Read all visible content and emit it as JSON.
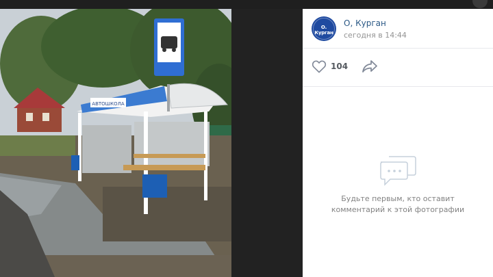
{
  "post": {
    "group_name": "О, Курган",
    "avatar_text": "О. Курган",
    "timestamp": "сегодня в 14:44"
  },
  "actions": {
    "like_count": "104"
  },
  "comments": {
    "empty_line1": "Будьте первым, кто оставит",
    "empty_line2": "комментарий к этой фотографии"
  },
  "photo": {
    "shelter_sign": "АВТОШКОЛА"
  },
  "colors": {
    "link": "#2a5885",
    "muted": "#939393",
    "icon": "#828a99",
    "accent": "#1f4aa0"
  },
  "icons": {
    "like": "heart-icon",
    "share": "share-arrow-icon",
    "empty_comments": "speech-bubble-icon"
  }
}
